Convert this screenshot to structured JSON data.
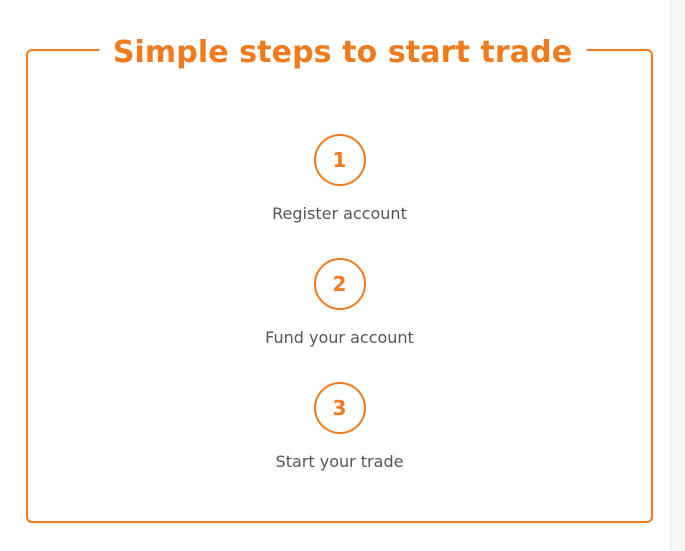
{
  "section": {
    "title": "Simple steps to start trade",
    "accent_color": "#f07b1f",
    "text_color": "#555555"
  },
  "steps": [
    {
      "number": "1",
      "label": "Register account"
    },
    {
      "number": "2",
      "label": "Fund your account"
    },
    {
      "number": "3",
      "label": "Start your trade"
    }
  ]
}
